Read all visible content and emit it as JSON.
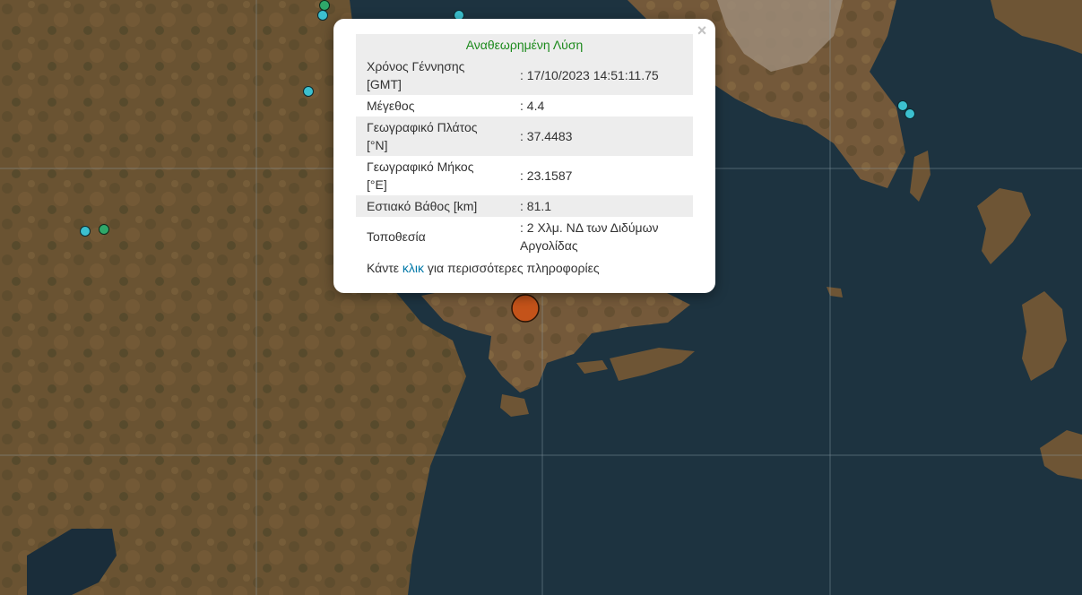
{
  "map": {
    "colors": {
      "sea": "#1d3340",
      "sea_deep": "#1a2d3a",
      "land": "#6b5332",
      "land_green": "#4f4a2a",
      "urban": "#9c8b78",
      "grid_line": "#8fa0a8"
    },
    "markers": [
      {
        "kind": "event-selected",
        "color": "#c4531a"
      },
      {
        "kind": "event",
        "color": "#3cc0cf"
      },
      {
        "kind": "event",
        "color": "#2fa86a"
      }
    ]
  },
  "popup": {
    "header": "Αναθεωρημένη Λύση",
    "close_label": "×",
    "rows": [
      {
        "key": "Χρόνος Γέννησης [GMT]",
        "value": ": 17/10/2023 14:51:11.75"
      },
      {
        "key": "Μέγεθος",
        "value": ": 4.4"
      },
      {
        "key": "Γεωγραφικό Πλάτος [°N]",
        "value": ": 37.4483"
      },
      {
        "key": "Γεωγραφικό Μήκος [°E]",
        "value": ": 23.1587"
      },
      {
        "key": "Εστιακό Βάθος [km]",
        "value": ": 81.1"
      },
      {
        "key": "Τοποθεσία",
        "value": ": 2 Χλμ. ΝΔ των Διδύμων Αργολίδας"
      }
    ],
    "more_prefix": "Κάντε ",
    "more_link": "κλικ",
    "more_suffix": " για περισσότερες πληροφορίες"
  }
}
